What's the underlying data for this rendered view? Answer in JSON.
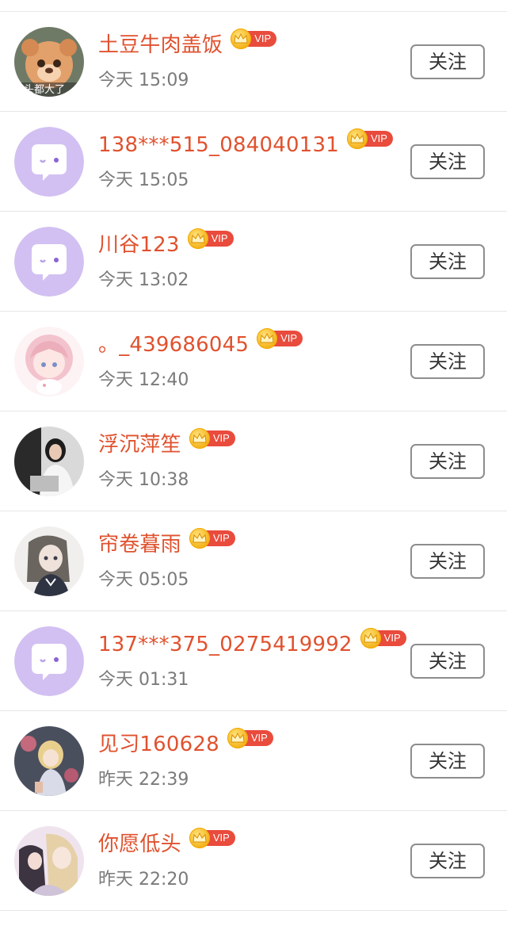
{
  "followers": [
    {
      "name": "土豆牛肉盖饭",
      "badge": "VIP",
      "time": "今天 15:09",
      "button": "关注",
      "avatar": "bear-avatar",
      "avatar_caption": "头都大了"
    },
    {
      "name": "138***515_084040131",
      "badge": "VIP",
      "time": "今天 15:05",
      "button": "关注",
      "avatar": "default-chat-avatar"
    },
    {
      "name": "川谷123",
      "badge": "VIP",
      "time": "今天 13:02",
      "button": "关注",
      "avatar": "default-chat-avatar"
    },
    {
      "name": "。_439686045",
      "badge": "VIP",
      "time": "今天 12:40",
      "button": "关注",
      "avatar": "anime-girl-pink-avatar"
    },
    {
      "name": "浮沉萍笙",
      "badge": "VIP",
      "time": "今天 10:38",
      "button": "关注",
      "avatar": "photo-girl-avatar"
    },
    {
      "name": "帘卷暮雨",
      "badge": "VIP",
      "time": "今天 05:05",
      "button": "关注",
      "avatar": "anime-sketch-avatar"
    },
    {
      "name": "137***375_0275419992",
      "badge": "VIP",
      "time": "今天 01:31",
      "button": "关注",
      "avatar": "default-chat-avatar"
    },
    {
      "name": "见习160628",
      "badge": "VIP",
      "time": "昨天 22:39",
      "button": "关注",
      "avatar": "anime-blonde-avatar"
    },
    {
      "name": "你愿低头",
      "badge": "VIP",
      "time": "昨天 22:20",
      "button": "关注",
      "avatar": "anime-couple-avatar"
    }
  ],
  "colors": {
    "name": "#e0522f",
    "vip_badge": "#e94b3c",
    "crown": "#f4b21a",
    "default_avatar": "#d2c0f2"
  }
}
